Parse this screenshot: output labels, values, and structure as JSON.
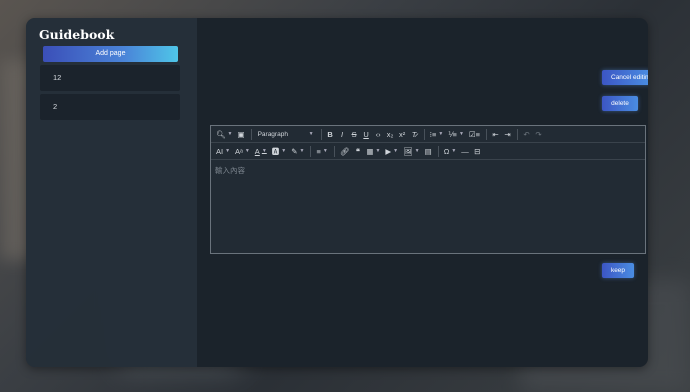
{
  "guidebook": {
    "title": "Guidebook",
    "add_page_label": "Add page",
    "pages": [
      {
        "label": "12"
      },
      {
        "label": "2"
      }
    ]
  },
  "actions": {
    "cancel_label": "Cancel editing",
    "delete_label": "delete",
    "keep_label": "keep"
  },
  "editor": {
    "paragraph_select": "Paragraph",
    "placeholder": "輸入內容",
    "toolbar_row1": [
      "find-replace-icon",
      "select-all-icon",
      "paragraph-select",
      "bold-icon",
      "italic-icon",
      "strikethrough-icon",
      "underline-icon",
      "code-icon",
      "subscript-icon",
      "superscript-icon",
      "remove-format-icon",
      "bulleted-list-icon",
      "numbered-list-icon",
      "todo-list-icon",
      "outdent-icon",
      "indent-icon",
      "undo-icon",
      "redo-icon"
    ],
    "toolbar_row2": [
      "text-case-icon",
      "font-size-icon",
      "font-color-icon",
      "font-background-icon",
      "highlight-icon",
      "alignment-icon",
      "link-icon",
      "blockquote-icon",
      "table-icon",
      "media-embed-icon",
      "insert-image-icon",
      "html-embed-icon",
      "special-characters-icon",
      "horizontal-line-icon",
      "page-break-icon"
    ]
  }
}
